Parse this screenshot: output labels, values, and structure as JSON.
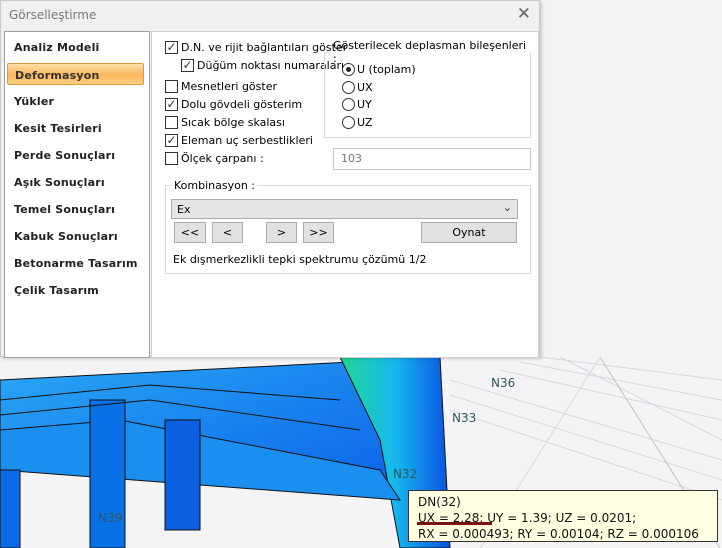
{
  "dialog": {
    "title": "Görselleştirme",
    "close_icon": "close-icon"
  },
  "sidebar": {
    "items": [
      {
        "label": "Analiz Modeli",
        "selected": false
      },
      {
        "label": "Deformasyon",
        "selected": true
      },
      {
        "label": "Yükler",
        "selected": false
      },
      {
        "label": "Kesit Tesirleri",
        "selected": false
      },
      {
        "label": "Perde Sonuçları",
        "selected": false
      },
      {
        "label": "Aşık Sonuçları",
        "selected": false
      },
      {
        "label": "Temel Sonuçları",
        "selected": false
      },
      {
        "label": "Kabuk Sonuçları",
        "selected": false
      },
      {
        "label": "Betonarme Tasarım",
        "selected": false
      },
      {
        "label": "Çelik Tasarım",
        "selected": false
      }
    ]
  },
  "options": {
    "checkboxes": [
      {
        "label": "D.N. ve rijit bağlantıları göster",
        "checked": true
      },
      {
        "label": "Düğüm noktası numaraları",
        "checked": true
      },
      {
        "label": "Mesnetleri göster",
        "checked": false
      },
      {
        "label": "Dolu gövdeli gösterim",
        "checked": true
      },
      {
        "label": "Sıcak bölge skalası",
        "checked": false
      },
      {
        "label": "Eleman uç serbestlikleri",
        "checked": true
      },
      {
        "label": "Ölçek çarpanı :",
        "checked": false
      }
    ],
    "scale_value": "103"
  },
  "displacement": {
    "legend": "Gösterilecek deplasman bileşenleri :",
    "radios": [
      {
        "label": "U (toplam)",
        "selected": true
      },
      {
        "label": "UX",
        "selected": false
      },
      {
        "label": "UY",
        "selected": false
      },
      {
        "label": "UZ",
        "selected": false
      }
    ]
  },
  "combination": {
    "legend": "Kombinasyon :",
    "selected": "Ex",
    "buttons": {
      "first": "<<",
      "prev": "<",
      "next": ">",
      "last": ">>",
      "play": "Oynat"
    },
    "status": "Ek dışmerkezlikli tepki spektrumu çözümü 1/2"
  },
  "viewport": {
    "nodes": [
      "N36",
      "N33",
      "N32",
      "N39"
    ],
    "tooltip": {
      "line1": "DN(32)",
      "line2": "UX = 2.28; UY = 1.39; UZ = 0.0201;",
      "line3": "RX = 0.000493; RY = 0.00104; RZ = 0.000106"
    }
  },
  "colors": {
    "selected_item": "#f9b75a",
    "tooltip_bg": "#ffffe1",
    "underline": "#7a1010",
    "structure": "#1e9cf0"
  }
}
